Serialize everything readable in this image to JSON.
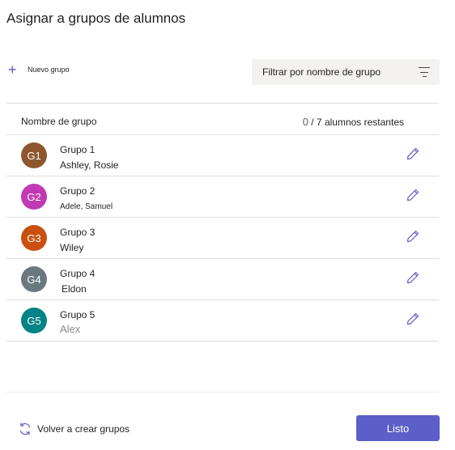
{
  "dialog": {
    "title": "Asignar a grupos de alumnos"
  },
  "toolbar": {
    "new_group_label": "Nuevo grupo",
    "filter_placeholder": "Filtrar por nombre de grupo",
    "icons": {
      "new_group": "plus-icon",
      "filter": "filter-icon"
    }
  },
  "list": {
    "header_label": "Nombre de grupo",
    "remaining_count": "0",
    "remaining_suffix": "/ 7 alumnos restantes",
    "groups": [
      {
        "initials": "G1",
        "name": "Grupo 1",
        "members": "Ashley, Rosie",
        "color": "#8e562e"
      },
      {
        "initials": "G2",
        "name": "Grupo 2",
        "members": "Adele, Samuel",
        "color": "#c239b3"
      },
      {
        "initials": "G3",
        "name": "Grupo 3",
        "members": "Wiley",
        "color": "#ca5010"
      },
      {
        "initials": "G4",
        "name": "Grupo 4",
        "members": "Eldon",
        "color": "#69797e"
      },
      {
        "initials": "G5",
        "name": "Grupo 5",
        "members": "Alex",
        "color": "#038387"
      }
    ]
  },
  "footer": {
    "reform_label": "Volver a crear grupos",
    "done_label": "Listo",
    "accent_color": "#5b5fc7"
  }
}
